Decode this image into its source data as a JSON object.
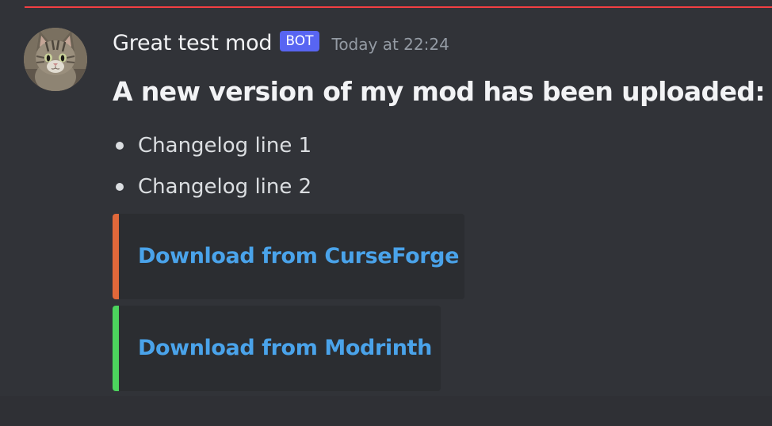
{
  "message": {
    "author": "Great test mod",
    "badge": "BOT",
    "timestamp": "Today at 22:24",
    "heading": "A new version of my mod has been uploaded:",
    "changelog": [
      "Changelog line 1",
      "Changelog line 2"
    ],
    "embeds": [
      {
        "title": "Download from CurseForge",
        "color": "#e0683a"
      },
      {
        "title": "Download from Modrinth",
        "color": "#4cd45d"
      }
    ]
  },
  "colors": {
    "background": "#313338",
    "new_messages_divider": "#f23f43",
    "bot_badge": "#5865f2",
    "link": "#4aa3ea",
    "embed_background": "#2b2d31"
  },
  "icons": {
    "avatar": "kitten-avatar-icon",
    "bullet": "bullet-dot-icon"
  }
}
